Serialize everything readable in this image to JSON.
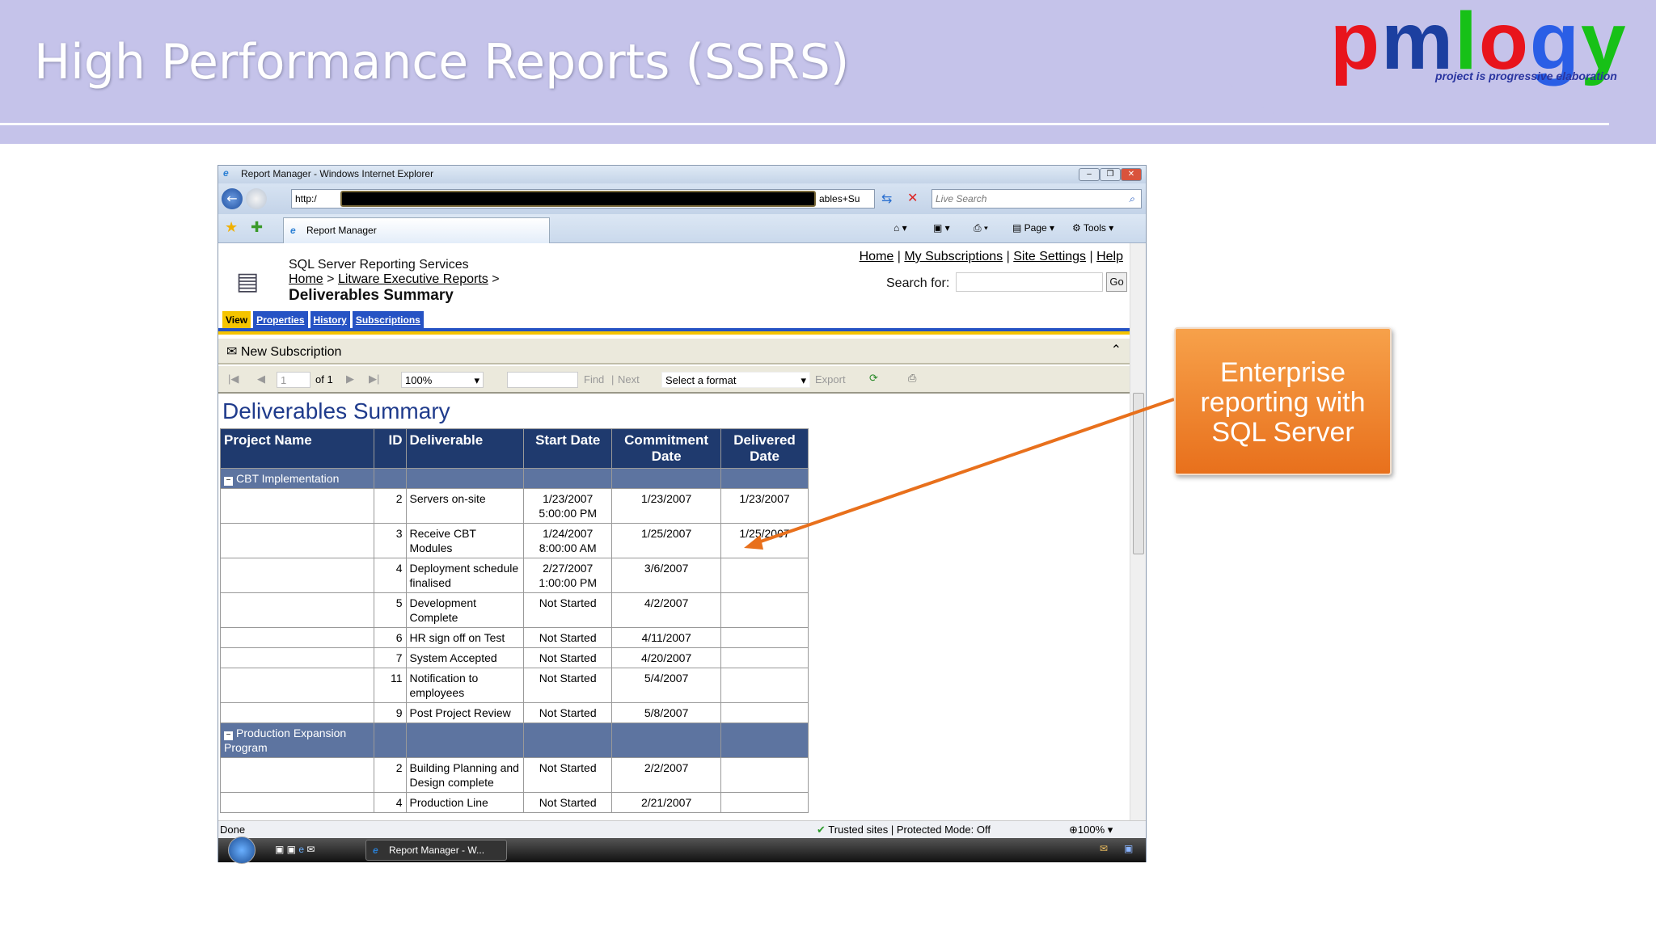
{
  "slide": {
    "title": "High Performance Reports (SSRS)",
    "logo": {
      "p": "p",
      "m": "m",
      "l": "l",
      "o": "o",
      "g": "g",
      "y": "y",
      "tagline": "project is progressive elaboration"
    },
    "callout": "Enterprise reporting with SQL Server"
  },
  "browser": {
    "title": "Report Manager - Windows Internet Explorer",
    "url_prefix": "http:/",
    "url_tail": "ables+Su",
    "search_placeholder": "Live Search",
    "tab": "Report Manager",
    "page_label": "Page",
    "tools_label": "Tools"
  },
  "ssrs": {
    "app": "SQL Server Reporting Services",
    "crumb_home": "Home",
    "crumb_sep": ">",
    "crumb_folder": "Litware Executive Reports",
    "title": "Deliverables Summary",
    "links": [
      "Home",
      "My Subscriptions",
      "Site Settings",
      "Help"
    ],
    "search_label": "Search for:",
    "go": "Go",
    "tabs": [
      "View",
      "Properties",
      "History",
      "Subscriptions"
    ],
    "new_subscription": "New Subscription",
    "toolbar": {
      "page": "1",
      "of": "of 1",
      "zoom": "100%",
      "find": "Find",
      "next": "Next",
      "format": "Select a format",
      "export": "Export"
    }
  },
  "report": {
    "title": "Deliverables Summary",
    "columns": [
      "Project Name",
      "ID",
      "Deliverable",
      "Start Date",
      "Commitment Date",
      "Delivered Date"
    ],
    "groups": [
      {
        "name": "CBT Implementation",
        "rows": [
          [
            "2",
            "Servers on-site",
            "1/23/2007 5:00:00 PM",
            "1/23/2007",
            "1/23/2007"
          ],
          [
            "3",
            "Receive CBT Modules",
            "1/24/2007 8:00:00 AM",
            "1/25/2007",
            "1/25/2007"
          ],
          [
            "4",
            "Deployment schedule finalised",
            "2/27/2007 1:00:00 PM",
            "3/6/2007",
            ""
          ],
          [
            "5",
            "Development Complete",
            "Not Started",
            "4/2/2007",
            ""
          ],
          [
            "6",
            "HR sign off on Test",
            "Not Started",
            "4/11/2007",
            ""
          ],
          [
            "7",
            "System Accepted",
            "Not Started",
            "4/20/2007",
            ""
          ],
          [
            "11",
            "Notification to employees",
            "Not Started",
            "5/4/2007",
            ""
          ],
          [
            "9",
            "Post Project Review",
            "Not Started",
            "5/8/2007",
            ""
          ]
        ]
      },
      {
        "name": "Production Expansion Program",
        "rows": [
          [
            "2",
            "Building Planning and Design complete",
            "Not Started",
            "2/2/2007",
            ""
          ],
          [
            "4",
            "Production Line",
            "Not Started",
            "2/21/2007",
            ""
          ]
        ]
      }
    ]
  },
  "status": {
    "text": "Done",
    "zone": "Trusted sites | Protected Mode: Off",
    "zoom": "100%"
  },
  "taskbar": {
    "window": "Report Manager - W..."
  }
}
